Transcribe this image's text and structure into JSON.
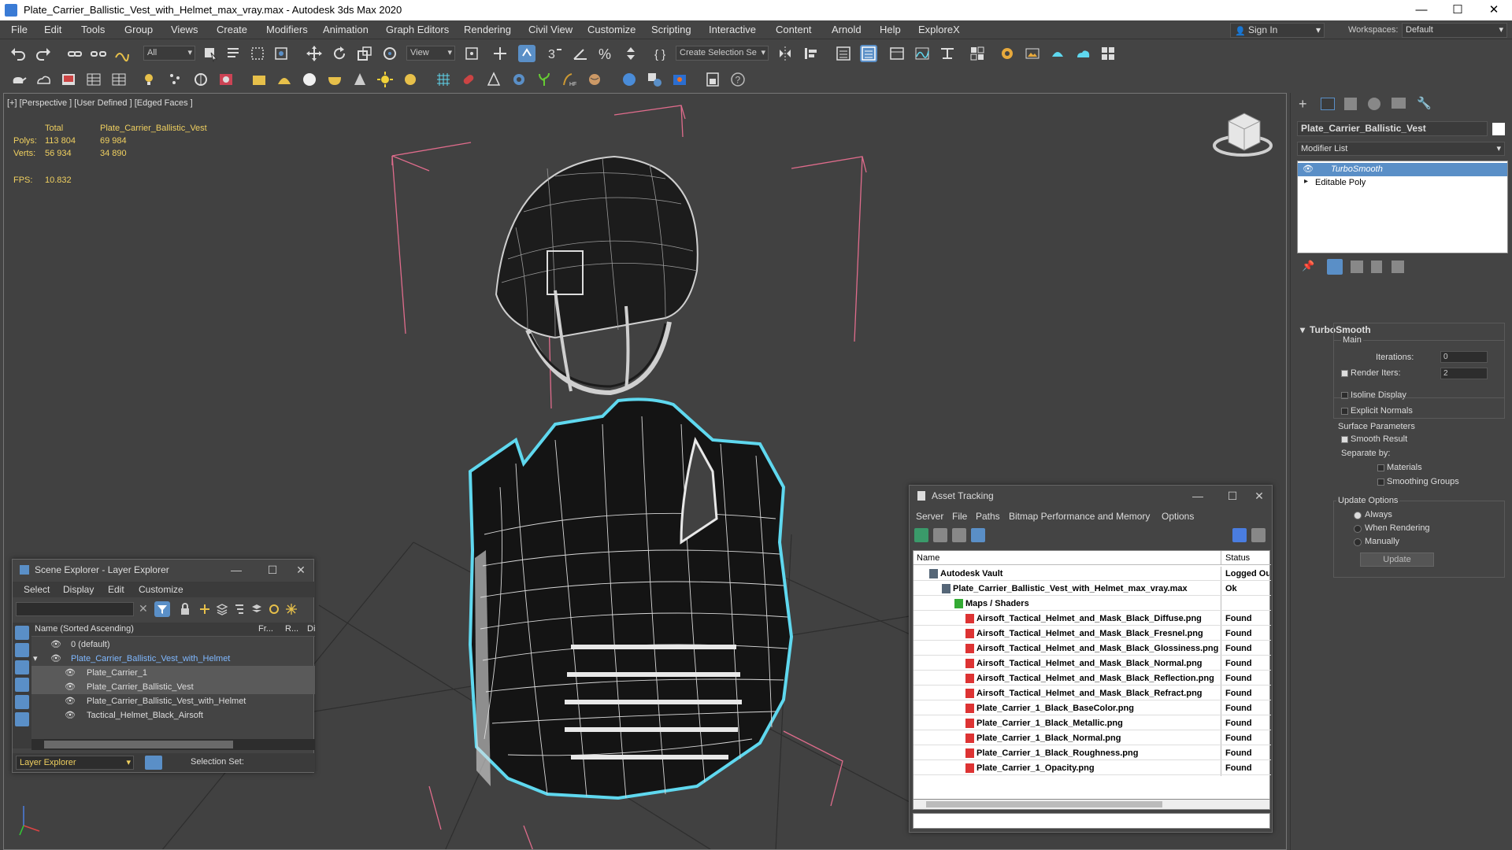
{
  "window": {
    "title": "Plate_Carrier_Ballistic_Vest_with_Helmet_max_vray.max - Autodesk 3ds Max 2020",
    "minimize": "—",
    "maximize": "☐",
    "close": "✕"
  },
  "menu": [
    "File",
    "Edit",
    "Tools",
    "Group",
    "Views",
    "Create",
    "Modifiers",
    "Animation",
    "Graph Editors",
    "Rendering",
    "Civil View",
    "Customize",
    "Scripting",
    "Interactive",
    "Content",
    "Arnold",
    "Help",
    "ExploreX"
  ],
  "account": {
    "sign_in": "Sign In",
    "workspaces_label": "Workspaces:",
    "workspace": "Default"
  },
  "toolbar": {
    "filter": "All",
    "ref_coord": "View",
    "selection_set": "Create Selection Se"
  },
  "viewport": {
    "label": "[+] [Perspective ] [User Defined ] [Edged Faces ]",
    "stats": {
      "total_label": "Total",
      "object_label": "Plate_Carrier_Ballistic_Vest",
      "polys_label": "Polys:",
      "polys_total": "113 804",
      "polys_obj": "69 984",
      "verts_label": "Verts:",
      "verts_total": "56 934",
      "verts_obj": "34 890",
      "fps_label": "FPS:",
      "fps": "10.832"
    }
  },
  "command_panel": {
    "object_name": "Plate_Carrier_Ballistic_Vest",
    "modifier_list": "Modifier List",
    "stack": [
      "TurboSmooth",
      "Editable Poly"
    ],
    "rollout_title": "TurboSmooth",
    "main": "Main",
    "iterations_label": "Iterations:",
    "iterations": "0",
    "render_iters_label": "Render Iters:",
    "render_iters": "2",
    "isoline": "Isoline Display",
    "explicit_normals": "Explicit Normals",
    "surface_params": "Surface Parameters",
    "smooth_result": "Smooth Result",
    "separate_by": "Separate by:",
    "materials": "Materials",
    "smoothing_groups": "Smoothing Groups",
    "update_options": "Update Options",
    "always": "Always",
    "when_rendering": "When Rendering",
    "manually": "Manually",
    "update_btn": "Update"
  },
  "scene_explorer": {
    "title": "Scene Explorer - Layer Explorer",
    "menu": [
      "Select",
      "Display",
      "Edit",
      "Customize"
    ],
    "col_name": "Name (Sorted Ascending)",
    "col_fr": "Fr...",
    "col_r": "R...",
    "col_d": "Di",
    "rows": [
      {
        "name": "0 (default)",
        "indent": 0
      },
      {
        "name": "Plate_Carrier_Ballistic_Vest_with_Helmet",
        "indent": 1
      },
      {
        "name": "Plate_Carrier_1",
        "indent": 2
      },
      {
        "name": "Plate_Carrier_Ballistic_Vest",
        "indent": 2
      },
      {
        "name": "Plate_Carrier_Ballistic_Vest_with_Helmet",
        "indent": 2
      },
      {
        "name": "Tactical_Helmet_Black_Airsoft",
        "indent": 2
      }
    ],
    "footer_layer": "Layer Explorer",
    "footer_selset": "Selection Set:"
  },
  "asset_tracking": {
    "title": "Asset Tracking",
    "menu": [
      "Server",
      "File",
      "Paths",
      "Bitmap Performance and Memory",
      "Options"
    ],
    "col_name": "Name",
    "col_status": "Status",
    "rows": [
      {
        "name": "Autodesk Vault",
        "status": "Logged Ou",
        "level": 1
      },
      {
        "name": "Plate_Carrier_Ballistic_Vest_with_Helmet_max_vray.max",
        "status": "Ok",
        "level": 2
      },
      {
        "name": "Maps / Shaders",
        "status": "",
        "level": 3
      },
      {
        "name": "Airsoft_Tactical_Helmet_and_Mask_Black_Diffuse.png",
        "status": "Found",
        "level": 4
      },
      {
        "name": "Airsoft_Tactical_Helmet_and_Mask_Black_Fresnel.png",
        "status": "Found",
        "level": 4
      },
      {
        "name": "Airsoft_Tactical_Helmet_and_Mask_Black_Glossiness.png",
        "status": "Found",
        "level": 4
      },
      {
        "name": "Airsoft_Tactical_Helmet_and_Mask_Black_Normal.png",
        "status": "Found",
        "level": 4
      },
      {
        "name": "Airsoft_Tactical_Helmet_and_Mask_Black_Reflection.png",
        "status": "Found",
        "level": 4
      },
      {
        "name": "Airsoft_Tactical_Helmet_and_Mask_Black_Refract.png",
        "status": "Found",
        "level": 4
      },
      {
        "name": "Plate_Carrier_1_Black_BaseColor.png",
        "status": "Found",
        "level": 4
      },
      {
        "name": "Plate_Carrier_1_Black_Metallic.png",
        "status": "Found",
        "level": 4
      },
      {
        "name": "Plate_Carrier_1_Black_Normal.png",
        "status": "Found",
        "level": 4
      },
      {
        "name": "Plate_Carrier_1_Black_Roughness.png",
        "status": "Found",
        "level": 4
      },
      {
        "name": "Plate_Carrier_1_Opacity.png",
        "status": "Found",
        "level": 4
      }
    ]
  },
  "colors": {
    "selection": "#5fd8ef",
    "bbox": "#e06c8c",
    "accent": "#5a8fc7",
    "stats": "#f0d060"
  }
}
